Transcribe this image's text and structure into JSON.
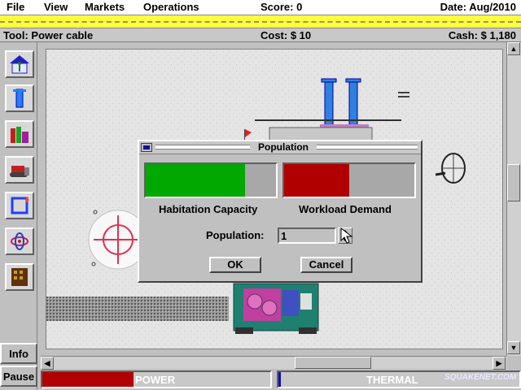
{
  "menu": {
    "items": [
      "File",
      "View",
      "Markets",
      "Operations"
    ],
    "score": "Score: 0",
    "date": "Date: Aug/2010"
  },
  "status": {
    "tool": "Tool: Power cable",
    "cost": "Cost: $ 10",
    "cash": "Cash: $ 1,180"
  },
  "sidebar": {
    "tools": [
      "habitat-tool-icon",
      "power-pylon-tool-icon",
      "industry-tool-icon",
      "bulldozer-tool-icon",
      "recycle-tool-icon",
      "reactor-tool-icon",
      "building-tool-icon"
    ],
    "info_label": "Info",
    "pause_label": "Pause"
  },
  "dialog": {
    "title": "Population",
    "habitation_label": "Habitation Capacity",
    "workload_label": "Workload Demand",
    "habitation_fill": 0.76,
    "workload_fill": 0.5,
    "population_label": "Population:",
    "population_value": "1",
    "ok_label": "OK",
    "cancel_label": "Cancel"
  },
  "gauges": {
    "power_label": "POWER",
    "power_fill": 0.4,
    "thermal_label": "THERMAL",
    "thermal_fill": 0.01
  },
  "watermark": "SQUAKENET.COM",
  "colors": {
    "habitation": "#00a800",
    "workload": "#b00000",
    "power": "#b00000",
    "thermal": "#1010b0",
    "band": "#ffff40"
  }
}
